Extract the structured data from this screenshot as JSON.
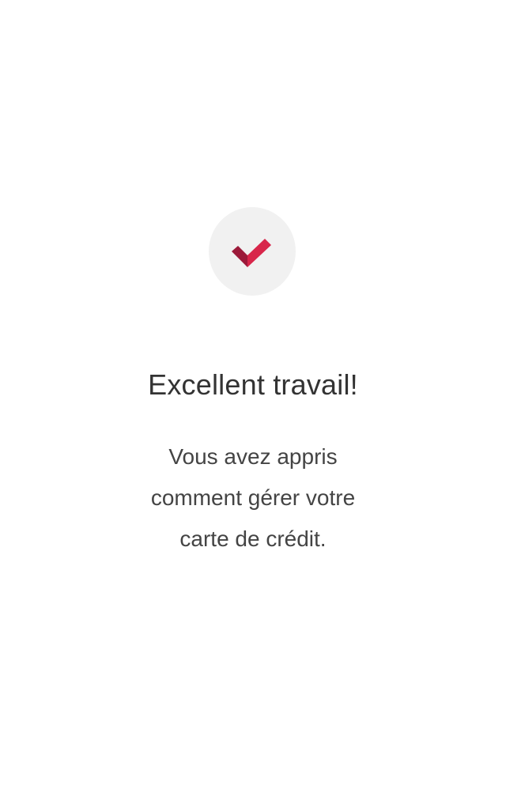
{
  "success": {
    "icon": "checkmark-icon",
    "title": "Excellent travail!",
    "message": "Vous avez appris comment gérer votre carte de crédit."
  },
  "colors": {
    "check_light": "#d8264a",
    "check_dark": "#9c1a3a",
    "circle": "#f1f1f1",
    "text": "#333333"
  }
}
